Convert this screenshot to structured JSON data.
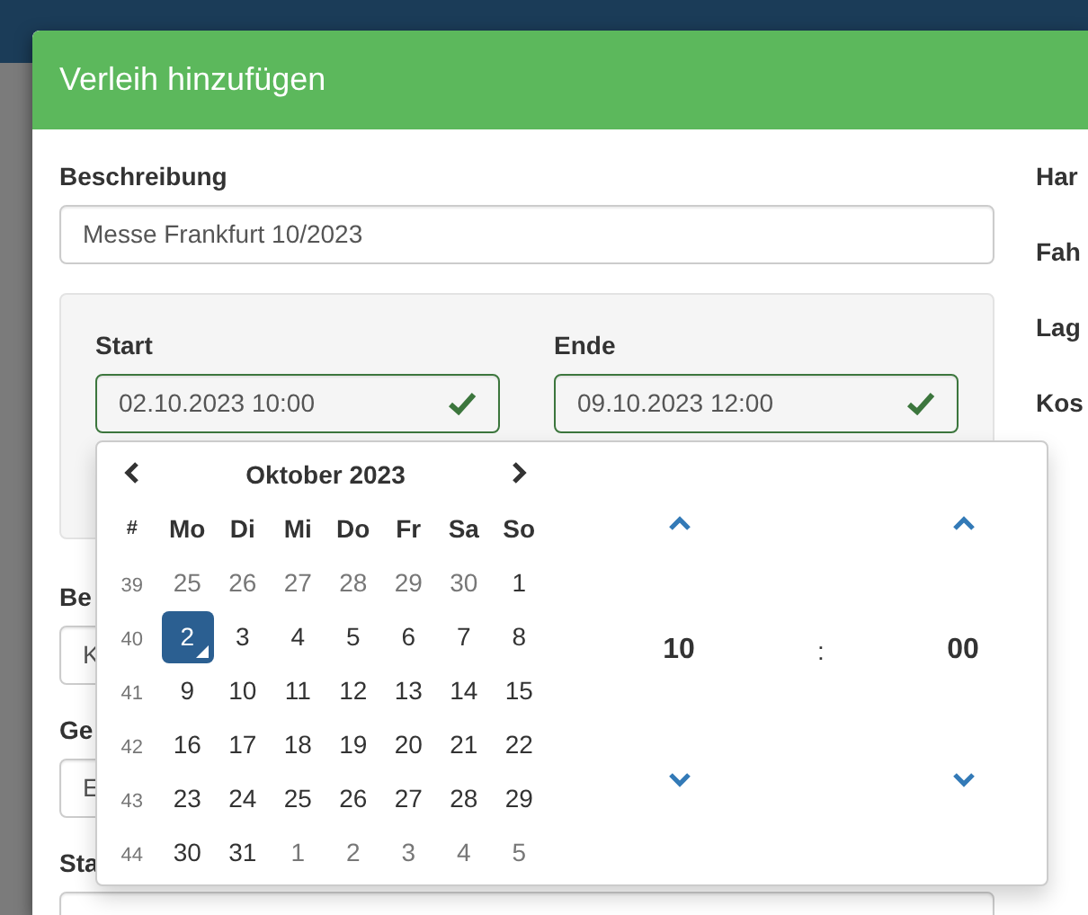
{
  "dialog": {
    "title": "Verleih hinzufügen"
  },
  "description": {
    "label": "Beschreibung",
    "value": "Messe Frankfurt 10/2023"
  },
  "period": {
    "start": {
      "label": "Start",
      "value": "02.10.2023 10:00",
      "valid": true
    },
    "end": {
      "label": "Ende",
      "value": "09.10.2023 12:00",
      "valid": true
    }
  },
  "lower_fields": [
    {
      "label": "Be",
      "value": "K"
    },
    {
      "label": "Ge",
      "value": "E"
    },
    {
      "label": "Sta"
    }
  ],
  "right_labels": [
    "Har",
    "Fah",
    "Lag",
    "Kos"
  ],
  "datepicker": {
    "month": "Oktober 2023",
    "week_header": "#",
    "weekdays": [
      "Mo",
      "Di",
      "Mi",
      "Do",
      "Fr",
      "Sa",
      "So"
    ],
    "weeks": [
      {
        "number": "39",
        "days": [
          {
            "label": "25",
            "other_month": true,
            "selected": false,
            "today": false
          },
          {
            "label": "26",
            "other_month": true,
            "selected": false,
            "today": false
          },
          {
            "label": "27",
            "other_month": true,
            "selected": false,
            "today": false
          },
          {
            "label": "28",
            "other_month": true,
            "selected": false,
            "today": false
          },
          {
            "label": "29",
            "other_month": true,
            "selected": false,
            "today": false
          },
          {
            "label": "30",
            "other_month": true,
            "selected": false,
            "today": false
          },
          {
            "label": "1",
            "other_month": false,
            "selected": false,
            "today": false
          }
        ]
      },
      {
        "number": "40",
        "days": [
          {
            "label": "2",
            "other_month": false,
            "selected": true,
            "today": true
          },
          {
            "label": "3",
            "other_month": false,
            "selected": false,
            "today": false
          },
          {
            "label": "4",
            "other_month": false,
            "selected": false,
            "today": false
          },
          {
            "label": "5",
            "other_month": false,
            "selected": false,
            "today": false
          },
          {
            "label": "6",
            "other_month": false,
            "selected": false,
            "today": false
          },
          {
            "label": "7",
            "other_month": false,
            "selected": false,
            "today": false
          },
          {
            "label": "8",
            "other_month": false,
            "selected": false,
            "today": false
          }
        ]
      },
      {
        "number": "41",
        "days": [
          {
            "label": "9",
            "other_month": false,
            "selected": false,
            "today": false
          },
          {
            "label": "10",
            "other_month": false,
            "selected": false,
            "today": false
          },
          {
            "label": "11",
            "other_month": false,
            "selected": false,
            "today": false
          },
          {
            "label": "12",
            "other_month": false,
            "selected": false,
            "today": false
          },
          {
            "label": "13",
            "other_month": false,
            "selected": false,
            "today": false
          },
          {
            "label": "14",
            "other_month": false,
            "selected": false,
            "today": false
          },
          {
            "label": "15",
            "other_month": false,
            "selected": false,
            "today": false
          }
        ]
      },
      {
        "number": "42",
        "days": [
          {
            "label": "16",
            "other_month": false,
            "selected": false,
            "today": false
          },
          {
            "label": "17",
            "other_month": false,
            "selected": false,
            "today": false
          },
          {
            "label": "18",
            "other_month": false,
            "selected": false,
            "today": false
          },
          {
            "label": "19",
            "other_month": false,
            "selected": false,
            "today": false
          },
          {
            "label": "20",
            "other_month": false,
            "selected": false,
            "today": false
          },
          {
            "label": "21",
            "other_month": false,
            "selected": false,
            "today": false
          },
          {
            "label": "22",
            "other_month": false,
            "selected": false,
            "today": false
          }
        ]
      },
      {
        "number": "43",
        "days": [
          {
            "label": "23",
            "other_month": false,
            "selected": false,
            "today": false
          },
          {
            "label": "24",
            "other_month": false,
            "selected": false,
            "today": false
          },
          {
            "label": "25",
            "other_month": false,
            "selected": false,
            "today": false
          },
          {
            "label": "26",
            "other_month": false,
            "selected": false,
            "today": false
          },
          {
            "label": "27",
            "other_month": false,
            "selected": false,
            "today": false
          },
          {
            "label": "28",
            "other_month": false,
            "selected": false,
            "today": false
          },
          {
            "label": "29",
            "other_month": false,
            "selected": false,
            "today": false
          }
        ]
      },
      {
        "number": "44",
        "days": [
          {
            "label": "30",
            "other_month": false,
            "selected": false,
            "today": false
          },
          {
            "label": "31",
            "other_month": false,
            "selected": false,
            "today": false
          },
          {
            "label": "1",
            "other_month": true,
            "selected": false,
            "today": false
          },
          {
            "label": "2",
            "other_month": true,
            "selected": false,
            "today": false
          },
          {
            "label": "3",
            "other_month": true,
            "selected": false,
            "today": false
          },
          {
            "label": "4",
            "other_month": true,
            "selected": false,
            "today": false
          },
          {
            "label": "5",
            "other_month": true,
            "selected": false,
            "today": false
          }
        ]
      }
    ],
    "time": {
      "hour": "10",
      "separator": ":",
      "minute": "00"
    }
  }
}
